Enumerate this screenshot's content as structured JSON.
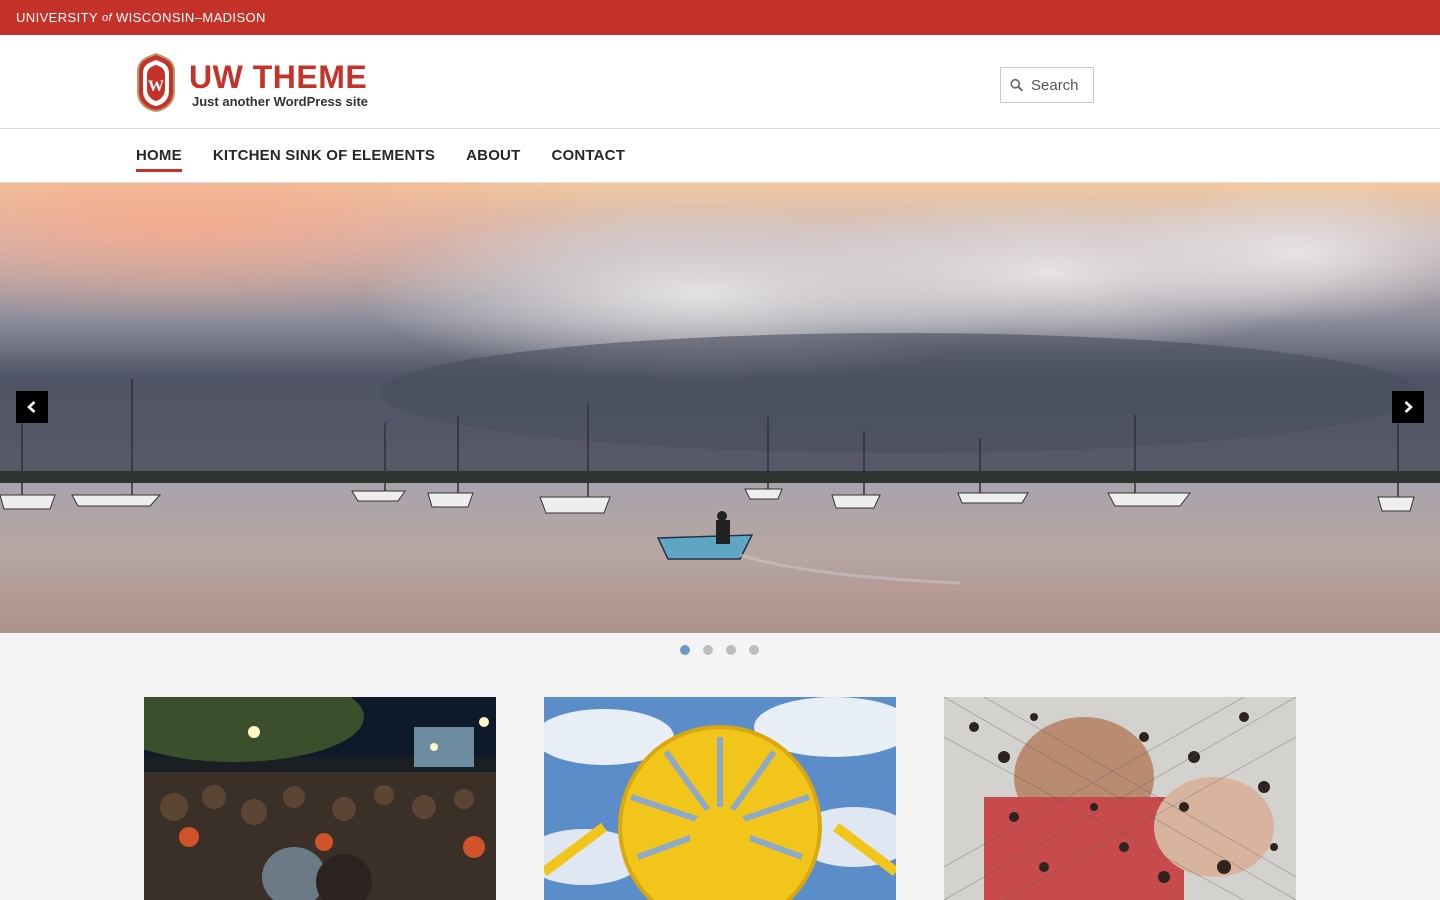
{
  "topbar": {
    "university_pre": "UNIVERSITY",
    "university_of": "of",
    "university_post": "WISCONSIN–MADISON"
  },
  "header": {
    "title": "UW THEME",
    "tagline": "Just another WordPress site",
    "crest_icon": "uw-crest-icon"
  },
  "search": {
    "placeholder": "Search"
  },
  "nav": {
    "items": [
      {
        "label": "HOME",
        "active": true
      },
      {
        "label": "KITCHEN SINK OF ELEMENTS"
      },
      {
        "label": "ABOUT"
      },
      {
        "label": "CONTACT"
      }
    ]
  },
  "carousel": {
    "slide_count": 4,
    "active_slide": 1,
    "prev_icon": "chevron-left-icon",
    "next_icon": "chevron-right-icon"
  },
  "cards": [
    {
      "image": "outdoor-concert-crowd-photo"
    },
    {
      "image": "yellow-terrace-chair-photo"
    },
    {
      "image": "soil-sifting-screen-photo"
    }
  ],
  "colors": {
    "brand_red": "#c5322a",
    "active_dot": "#6d9ac2"
  }
}
